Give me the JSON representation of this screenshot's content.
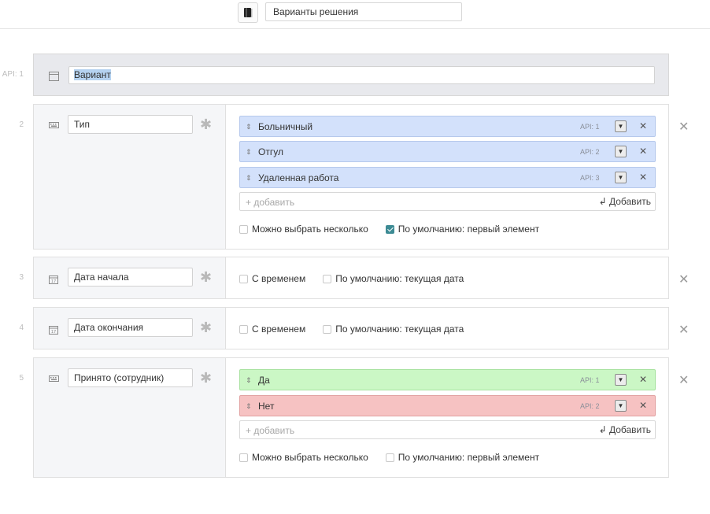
{
  "header": {
    "title_value": "Варианты решения",
    "doc_icon": "book-icon"
  },
  "rows": {
    "r1": {
      "num": "API: 1",
      "name": "Вариант",
      "icon": "window-icon"
    },
    "r2": {
      "num": "2",
      "name": "Тип",
      "icon": "keyboard-icon",
      "options": [
        {
          "label": "Больничный",
          "api": "API: 1"
        },
        {
          "label": "Отгул",
          "api": "API: 2"
        },
        {
          "label": "Удаленная работа",
          "api": "API: 3"
        }
      ],
      "add_placeholder": "+ добавить",
      "add_button": "Добавить",
      "multi_label": "Можно выбрать несколько",
      "default_label": "По умолчанию: первый элемент",
      "default_checked": true
    },
    "r3": {
      "num": "3",
      "name": "Дата начала",
      "icon": "calendar-icon",
      "time_label": "С временем",
      "default_label": "По умолчанию: текущая дата"
    },
    "r4": {
      "num": "4",
      "name": "Дата окончания",
      "icon": "calendar-icon",
      "time_label": "С временем",
      "default_label": "По умолчанию: текущая дата"
    },
    "r5": {
      "num": "5",
      "name": "Принято (сотрудник)",
      "icon": "keyboard-icon",
      "options": [
        {
          "label": "Да",
          "api": "API: 1",
          "color": "#cbf7c5"
        },
        {
          "label": "Нет",
          "api": "API: 2",
          "color": "#f6c2c2"
        }
      ],
      "add_placeholder": "+ добавить",
      "add_button": "Добавить",
      "multi_label": "Можно выбрать несколько",
      "default_label": "По умолчанию: первый элемент",
      "default_checked": false
    }
  },
  "colors": {
    "option_blue": "#d3e1fb",
    "option_green": "#cbf7c5",
    "option_red": "#f6c2c2",
    "checkbox_checked": "#3d8b94"
  }
}
